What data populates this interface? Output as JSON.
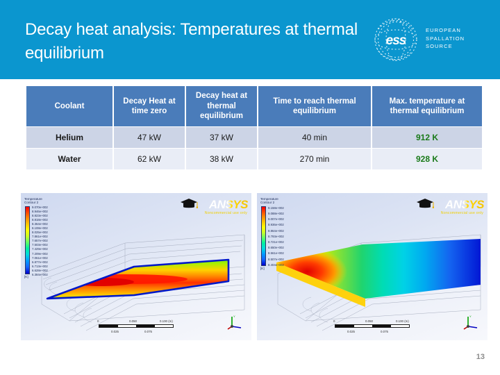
{
  "header": {
    "title": "Decay heat analysis: Temperatures at thermal equilibrium",
    "band_color": "#0b96cf",
    "logo": {
      "mark_text": "ess",
      "line1": "EUROPEAN",
      "line2": "SPALLATION",
      "line3": "SOURCE"
    }
  },
  "table": {
    "header_color": "#4a7cba",
    "row_a_color": "#ccd4e6",
    "row_b_color": "#e9edf6",
    "highlight_color": "#1a7a1a",
    "columns": [
      "Coolant",
      "Decay Heat at time zero",
      "Decay heat at thermal equilibrium",
      "Time to reach thermal equilibrium",
      "Max. temperature at thermal equilibrium"
    ],
    "rows": [
      {
        "coolant": "Helium",
        "decay_heat_time_zero": "47 kW",
        "decay_heat_thermal_eq": "37 kW",
        "time_to_reach": "40 min",
        "max_temperature": "912 K"
      },
      {
        "coolant": "Water",
        "decay_heat_time_zero": "62 kW",
        "decay_heat_thermal_eq": "38 kW",
        "time_to_reach": "270 min",
        "max_temperature": "928 K"
      }
    ]
  },
  "figures": [
    {
      "name": "helium-contour-plot",
      "legend_title_line1": "Temperature",
      "legend_title_line2": "Contour 2",
      "legend_unit": "[K]",
      "legend_ticks": [
        "9.070e+002",
        "8.946e+002",
        "8.823e+002",
        "8.818e+002",
        "8.364e+002",
        "8.108e+002",
        "8.025e+002",
        "7.861e+002",
        "7.657e+002",
        "7.503e+002",
        "7.429e+002",
        "7.209e+002",
        "7.061e+002",
        "6.877e+002",
        "6.713e+002",
        "6.628e+002",
        "6.384e+002"
      ],
      "ansys_word": "ANSYS",
      "ansys_sub": "Noncommercial use only",
      "scale_top": [
        "0",
        "0.050",
        "0.100 (m)"
      ],
      "scale_bottom": [
        "0.025",
        "0.075"
      ]
    },
    {
      "name": "water-contour-plot",
      "legend_title_line1": "Temperature",
      "legend_title_line2": "Contour 2",
      "legend_unit": "[K]",
      "legend_ticks": [
        "9.158e+002",
        "9.088e+002",
        "9.007e+002",
        "8.936e+002",
        "8.864e+002",
        "8.793e+002",
        "8.721e+002",
        "8.650e+002",
        "8.561e+002",
        "8.507e+002",
        "8.404e+002"
      ],
      "ansys_word": "ANSYS",
      "ansys_sub": "Noncommercial use only",
      "scale_top": [
        "0",
        "0.050",
        "0.100 (m)"
      ],
      "scale_bottom": [
        "0.025",
        "0.075"
      ]
    }
  ],
  "footer": {
    "page_number": "13"
  }
}
